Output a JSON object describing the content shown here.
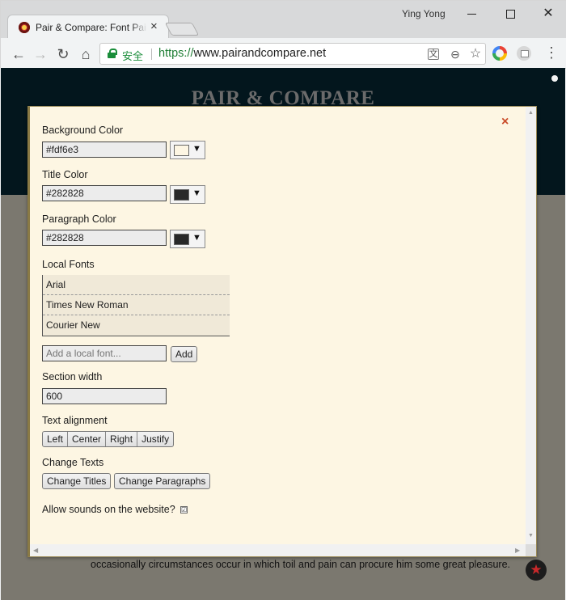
{
  "browser": {
    "tab_title": "Pair & Compare: Font Pairing",
    "tab_close": "×",
    "user_name": "Ying Yong",
    "window_minimize": "",
    "window_maximize": "",
    "window_close": "✕",
    "nav_back": "←",
    "nav_forward": "→",
    "nav_reload": "↻",
    "nav_home": "⌂",
    "secure_label": "安全",
    "url_scheme": "https://",
    "url_host": "www.pairandcompare.net",
    "menu": "⋮",
    "icons": [
      "translate-icon",
      "zoom-icon",
      "star-icon",
      "chrome-ext-icon",
      "cast-ext-icon"
    ]
  },
  "page": {
    "hero_title": "PAIR & COMPARE",
    "paragraph": "occasionally circumstances occur in which toil and pain can procure him some great pleasure.",
    "fab_icon": "★",
    "colors": {
      "hero_bg": "#03161d",
      "page_bg": "#7b786f"
    }
  },
  "modal": {
    "close": "×",
    "background_color": {
      "label": "Background Color",
      "value": "#fdf6e3",
      "swatch": "#fdf6e3"
    },
    "title_color": {
      "label": "Title Color",
      "value": "#282828",
      "swatch": "#282828"
    },
    "paragraph_color": {
      "label": "Paragraph Color",
      "value": "#282828",
      "swatch": "#282828"
    },
    "dropdown_arrow": "▼",
    "local_fonts": {
      "label": "Local Fonts",
      "items": [
        "Arial",
        "Times New Roman",
        "Courier New"
      ],
      "placeholder": "Add a local font...",
      "add_label": "Add"
    },
    "section_width": {
      "label": "Section width",
      "value": "600"
    },
    "text_alignment": {
      "label": "Text alignment",
      "options": [
        "Left",
        "Center",
        "Right",
        "Justify"
      ]
    },
    "change_texts": {
      "label": "Change Texts",
      "titles_button": "Change Titles",
      "paragraphs_button": "Change Paragraphs"
    },
    "sounds": {
      "label": "Allow sounds on the website?",
      "checked": "☑"
    }
  }
}
